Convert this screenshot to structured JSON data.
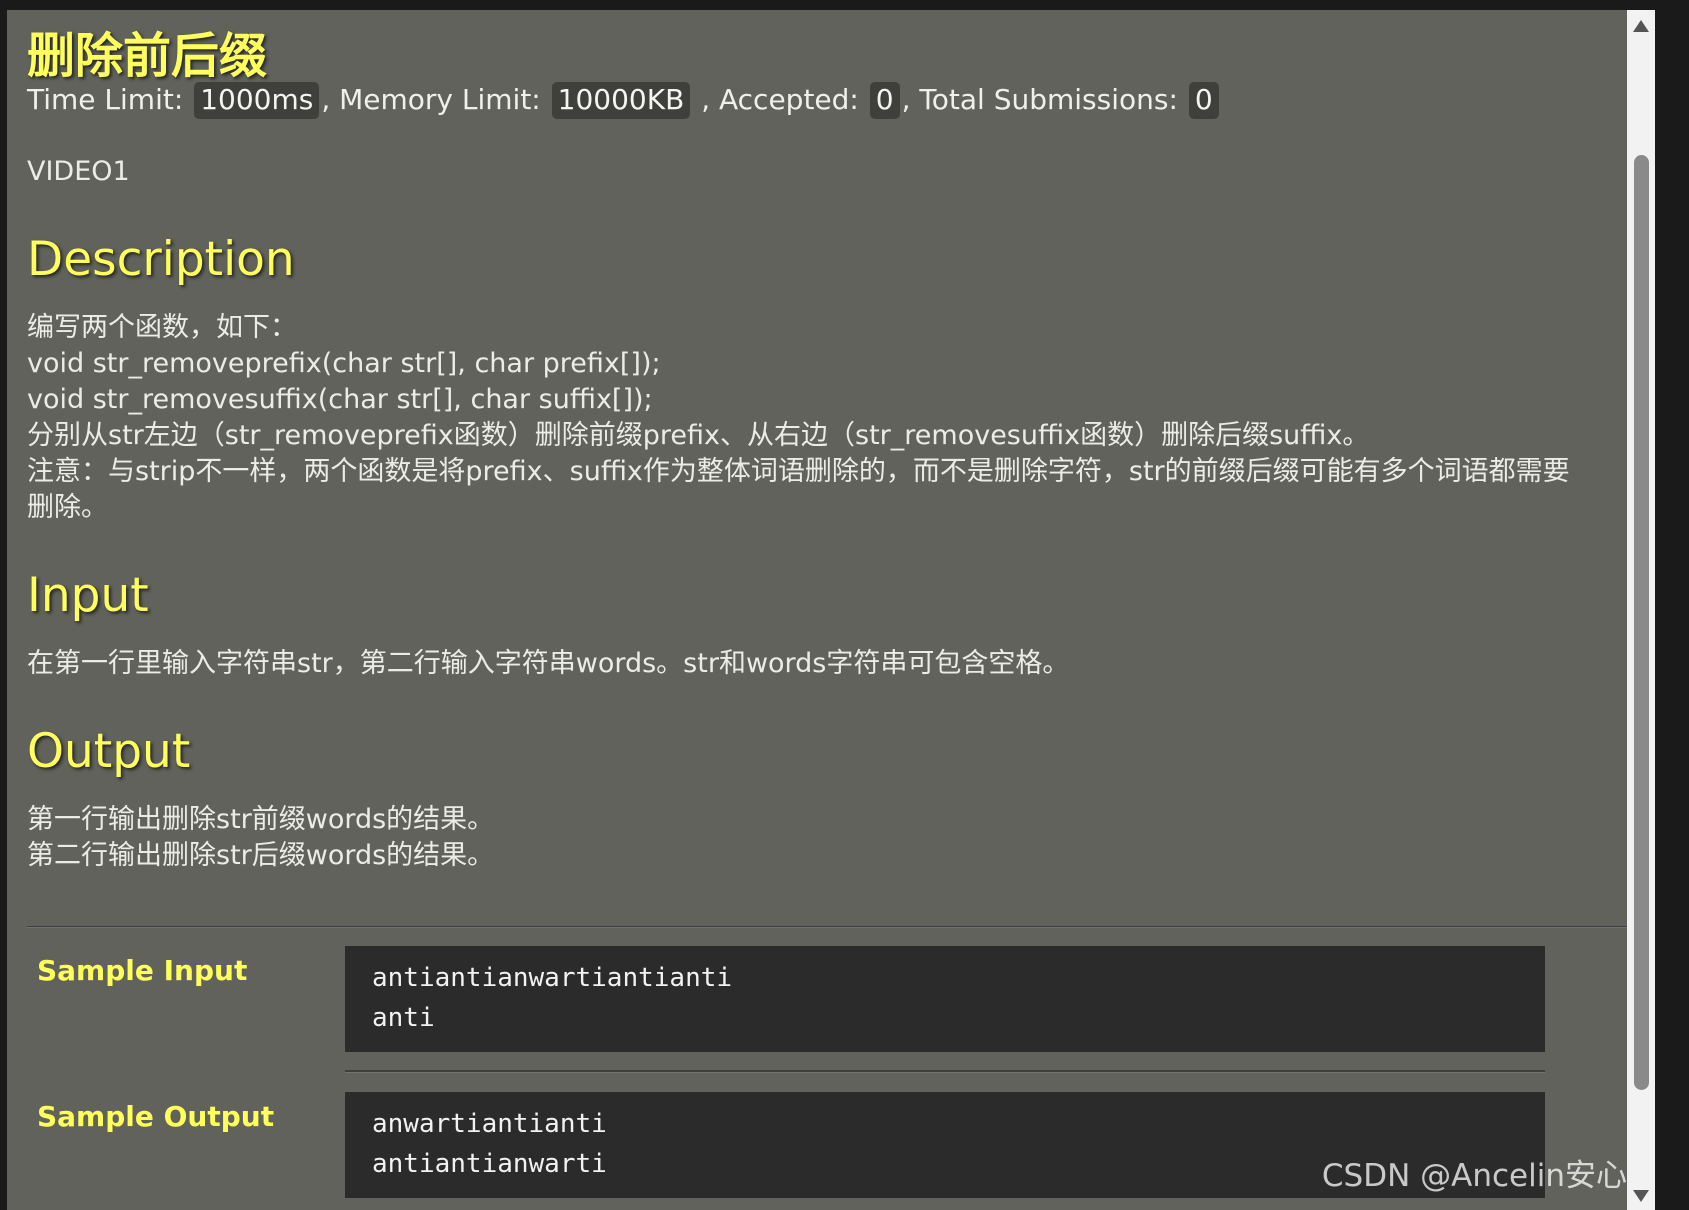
{
  "problem": {
    "title": "删除前后缀",
    "meta": {
      "time_limit_label": "Time Limit:",
      "time_limit_value": "1000ms",
      "memory_limit_label": ", Memory Limit:",
      "memory_limit_value": "10000KB",
      "accepted_label": " , Accepted:",
      "accepted_value": "0",
      "submissions_label": ", Total Submissions:",
      "submissions_value": "0"
    },
    "video": "VIDEO1"
  },
  "description": {
    "heading": "Description",
    "lines": [
      "编写两个函数，如下：",
      "void str_removeprefix(char str[], char prefix[]);",
      "void str_removesuffix(char str[], char suffix[]);",
      "分别从str左边（str_removeprefix函数）删除前缀prefix、从右边（str_removesuffix函数）删除后缀suffix。",
      "注意：与strip不一样，两个函数是将prefix、suffix作为整体词语删除的，而不是删除字符，str的前缀后缀可能有多个词语都需要",
      "删除。"
    ]
  },
  "input": {
    "heading": "Input",
    "lines": [
      "在第一行里输入字符串str，第二行输入字符串words。str和words字符串可包含空格。"
    ]
  },
  "output": {
    "heading": "Output",
    "lines": [
      "第一行输出删除str前缀words的结果。",
      "第二行输出删除str后缀words的结果。"
    ]
  },
  "sample_input": {
    "label": "Sample Input",
    "lines": [
      "antiantianwartiantianti",
      "anti"
    ]
  },
  "sample_output": {
    "label": "Sample Output",
    "lines": [
      "anwartiantianti",
      "antiantianwarti"
    ]
  },
  "watermark": "CSDN @Ancelin安心",
  "icons": {
    "scroll_up": "arrow-up-icon",
    "scroll_down": "arrow-down-icon"
  },
  "colors": {
    "background": "#62625c",
    "heading": "#ffff5c",
    "code_background": "#2b2b2b"
  }
}
